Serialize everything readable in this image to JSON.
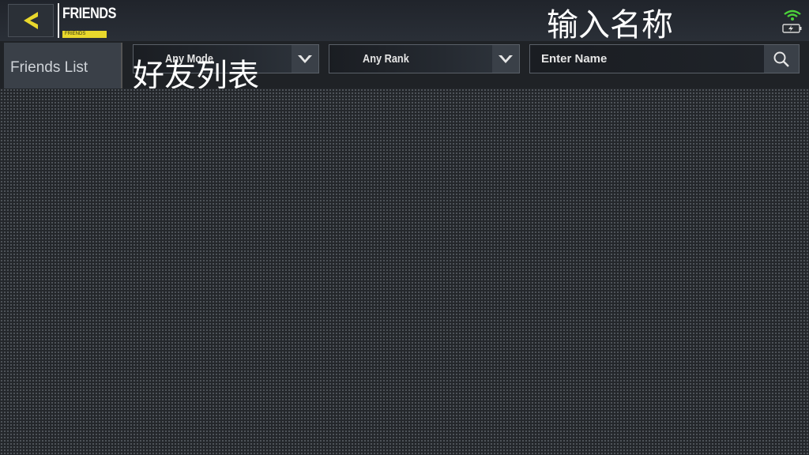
{
  "header": {
    "title": "FRIENDS",
    "title_tag": "FRIENDS",
    "back_icon": "back-arrow-icon",
    "accent_color": "#e9d82c"
  },
  "overlay": {
    "search_caption": "输入名称",
    "friends_caption": "好友列表"
  },
  "status": {
    "wifi_icon": "wifi-icon",
    "battery_icon": "battery-charging-icon",
    "wifi_color": "#4cd13a"
  },
  "sidebar": {
    "items": [
      {
        "label": "Friends List"
      }
    ]
  },
  "filters": {
    "mode": {
      "value": "Any Mode"
    },
    "rank": {
      "value": "Any Rank"
    }
  },
  "search": {
    "placeholder": "Enter Name",
    "icon": "search-icon"
  }
}
